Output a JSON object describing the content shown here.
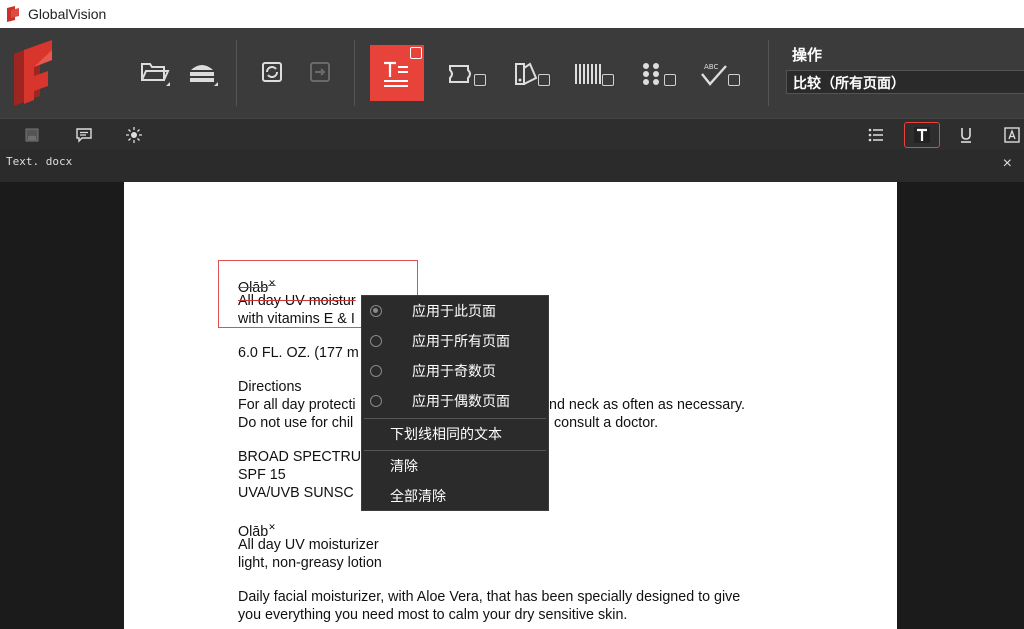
{
  "window": {
    "title": "GlobalVision"
  },
  "toolbar": {
    "open_icon": "folder-open-icon",
    "scanner_icon": "scanner-icon",
    "refresh_icon": "refresh-icon",
    "export_icon": "export-icon",
    "modes": [
      {
        "name": "text-compare",
        "icon": "text-compare-icon",
        "active": true
      },
      {
        "name": "graphics-compare",
        "icon": "graphics-icon",
        "active": false
      },
      {
        "name": "color-compare",
        "icon": "color-icon",
        "active": false
      },
      {
        "name": "barcode",
        "icon": "barcode-icon",
        "active": false
      },
      {
        "name": "braille",
        "icon": "braille-icon",
        "active": false
      },
      {
        "name": "spelling",
        "icon": "spell-check-icon",
        "active": false
      }
    ],
    "operation_label": "操作",
    "operation_value": "比较（所有页面）",
    "accent_color": "#e8433a"
  },
  "toolbar2": {
    "left_icons": [
      "page-icon",
      "comment-icon",
      "sun-icon"
    ],
    "right_icons": [
      "list-icon",
      "text-icon",
      "underline-icon",
      "textbox-icon"
    ],
    "selected": "text-icon"
  },
  "tab": {
    "filename": "Text. docx",
    "close": "×"
  },
  "document": {
    "block1": [
      "Olāb",
      "All day UV moistur",
      "with vitamins E & I"
    ],
    "block2": "6.0 FL. OZ. (177 m",
    "directions": [
      "Directions",
      "For all day protecti",
      "Do not use for chil"
    ],
    "directions_right": [
      "nd neck as often as necessary.",
      "consult a doctor."
    ],
    "broad": [
      "BROAD SPECTRU",
      "SPF 15",
      "UVA/UVB SUNSC"
    ],
    "block4": [
      "Olāb",
      "All day UV moisturizer",
      "light, non-greasy lotion"
    ],
    "block5": [
      "Daily facial moisturizer, with Aloe Vera, that has been specially designed to give",
      "you everything you need most to calm your dry sensitive skin."
    ]
  },
  "context_menu": {
    "radio_items": [
      {
        "label": "应用于此页面",
        "selected": true
      },
      {
        "label": "应用于所有页面",
        "selected": false
      },
      {
        "label": "应用于奇数页",
        "selected": false
      },
      {
        "label": "应用于偶数页面",
        "selected": false
      }
    ],
    "underline_same": "下划线相同的文本",
    "clear": "清除",
    "clear_all": "全部清除"
  }
}
